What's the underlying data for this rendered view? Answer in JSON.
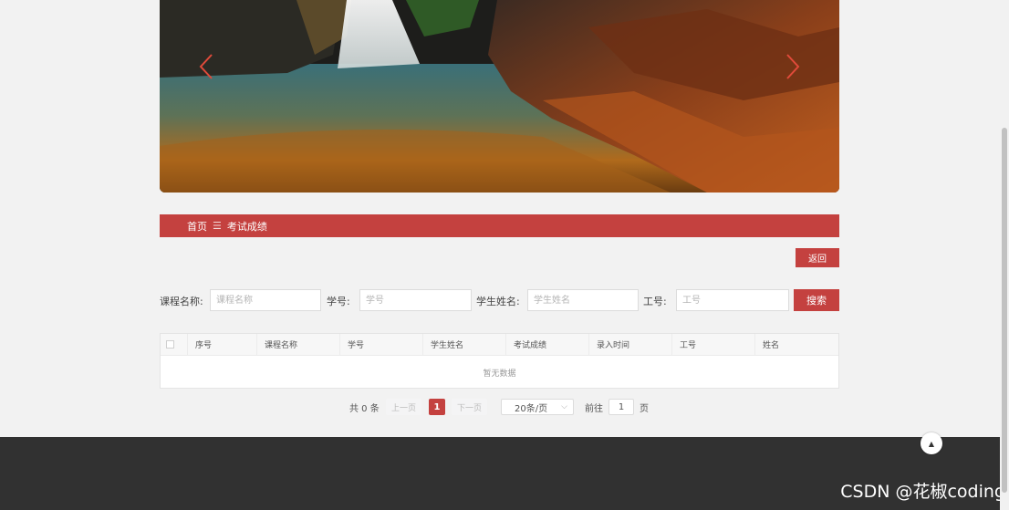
{
  "breadcrumb": {
    "home": "首页",
    "separator": "☰",
    "current": "考试成绩"
  },
  "actions": {
    "back_label": "返回",
    "search_label": "搜索"
  },
  "filters": [
    {
      "label": "课程名称:",
      "placeholder": "课程名称"
    },
    {
      "label": "学号:",
      "placeholder": "学号"
    },
    {
      "label": "学生姓名:",
      "placeholder": "学生姓名"
    },
    {
      "label": "工号:",
      "placeholder": "工号"
    }
  ],
  "table": {
    "columns": [
      "序号",
      "课程名称",
      "学号",
      "学生姓名",
      "考试成绩",
      "录入时间",
      "工号",
      "姓名"
    ],
    "empty_text": "暂无数据"
  },
  "pagination": {
    "total": "共 0 条",
    "prev": "上一页",
    "current_page": "1",
    "next": "下一页",
    "page_size": "20条/页",
    "goto_label": "前往",
    "goto_value": "1",
    "page_unit": "页"
  },
  "watermark": "CSDN @花椒coding",
  "icons": {
    "prev": "chevron-left-icon",
    "next": "chevron-right-icon",
    "top": "arrow-up-icon"
  },
  "colors": {
    "accent": "#c4413f",
    "footer": "#313131"
  }
}
